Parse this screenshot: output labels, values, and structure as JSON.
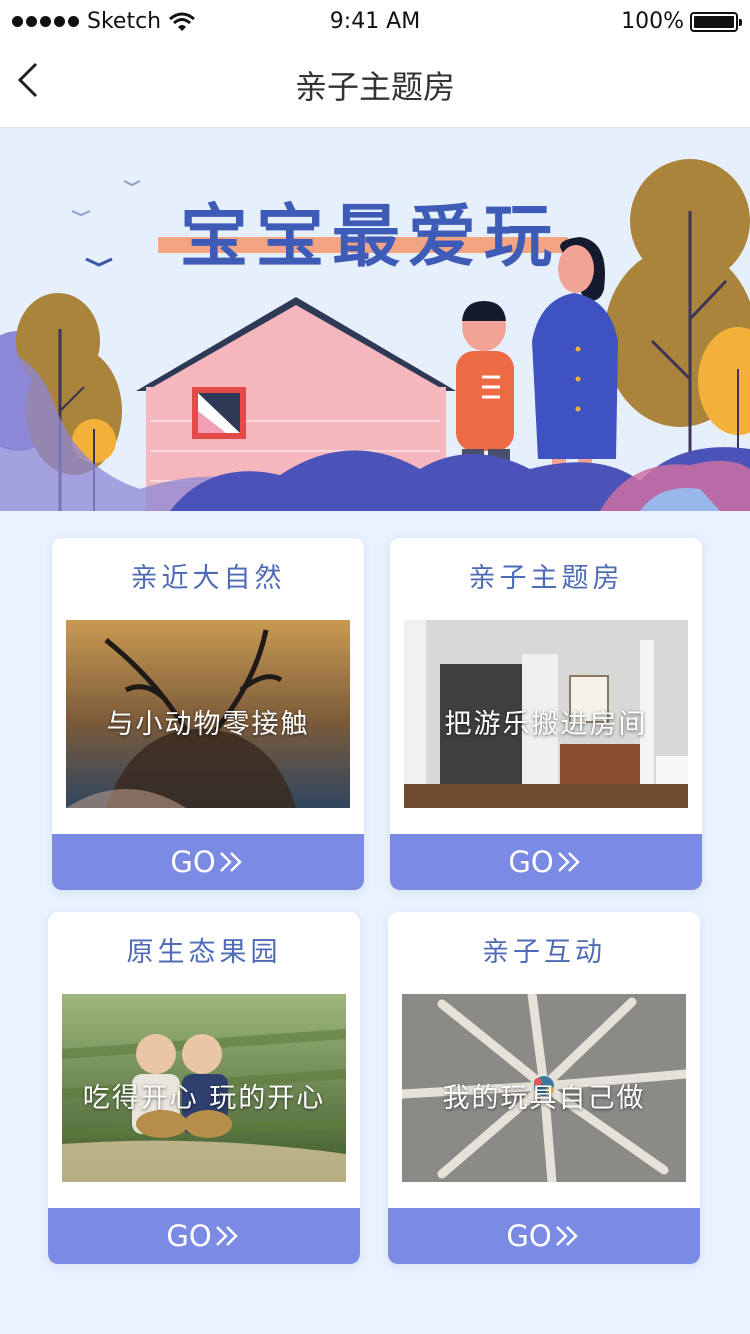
{
  "status_bar": {
    "carrier": "Sketch",
    "time": "9:41 AM",
    "battery": "100%"
  },
  "nav": {
    "title": "亲子主题房"
  },
  "banner": {
    "headline": "宝宝最爱玩"
  },
  "cards": [
    {
      "title": "亲近大自然",
      "caption": "与小动物零接触",
      "button": "GO"
    },
    {
      "title": "亲子主题房",
      "caption": "把游乐搬进房间",
      "button": "GO"
    },
    {
      "title": "原生态果园",
      "caption": "吃得开心 玩的开心",
      "button": "GO"
    },
    {
      "title": "亲子互动",
      "caption": "我的玩具自己做",
      "button": "GO"
    }
  ],
  "colors": {
    "accent": "#7b8be3",
    "title_text": "#4f6bb5",
    "page_bg": "#e8f1fd"
  }
}
